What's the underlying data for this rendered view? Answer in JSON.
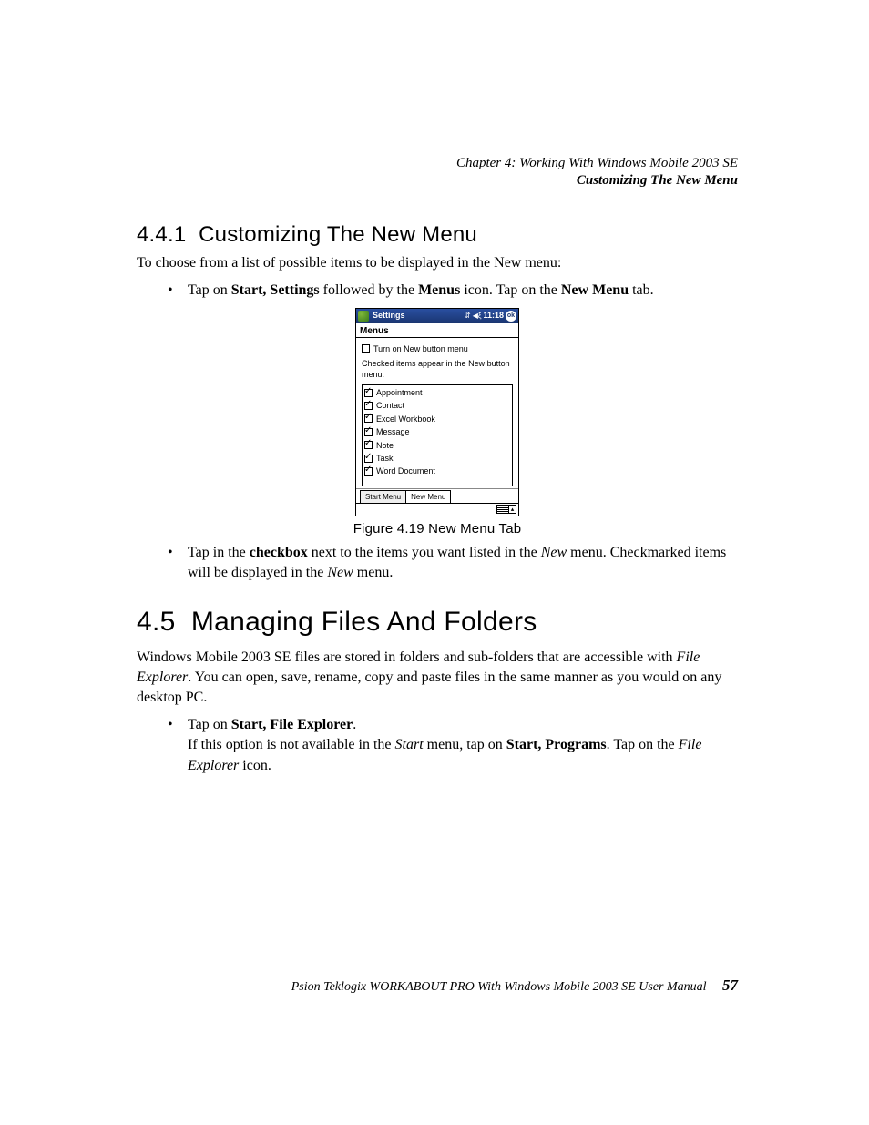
{
  "header": {
    "chapter_line": "Chapter  4:  Working With Windows Mobile 2003 SE",
    "section_line": "Customizing The New Menu"
  },
  "section_441": {
    "number": "4.4.1",
    "title": "Customizing The New Menu",
    "intro": "To choose from a list of possible items to be displayed in the New menu:",
    "bullet1_pre": "Tap on ",
    "bullet1_b1": "Start, Settings",
    "bullet1_mid": " followed by the ",
    "bullet1_b2": "Menus",
    "bullet1_mid2": " icon. Tap on the ",
    "bullet1_b3": "New Menu",
    "bullet1_post": " tab.",
    "bullet2_pre": "Tap in the ",
    "bullet2_b1": "checkbox",
    "bullet2_mid": " next to the items you want listed in the ",
    "bullet2_i1": "New",
    "bullet2_mid2": " menu. Checkmarked items will be displayed in the ",
    "bullet2_i2": "New",
    "bullet2_post": " menu."
  },
  "figure": {
    "caption": "Figure 4.19 New Menu Tab"
  },
  "mock": {
    "title": "Settings",
    "clock": "11:18",
    "ok": "ok",
    "subtitle": "Menus",
    "turn_on_label": "Turn on New button menu",
    "turn_on_checked": false,
    "hint": "Checked items appear in the New button menu.",
    "items": [
      {
        "label": "Appointment",
        "checked": true
      },
      {
        "label": "Contact",
        "checked": true
      },
      {
        "label": "Excel Workbook",
        "checked": true
      },
      {
        "label": "Message",
        "checked": true
      },
      {
        "label": "Note",
        "checked": true
      },
      {
        "label": "Task",
        "checked": true
      },
      {
        "label": "Word Document",
        "checked": true
      }
    ],
    "tab_start": "Start Menu",
    "tab_new": "New Menu"
  },
  "section_45": {
    "number": "4.5",
    "title": "Managing Files And Folders",
    "para_pre": "Windows Mobile 2003 SE files are stored in folders and sub-folders that are accessible with ",
    "para_i1": "File Explorer",
    "para_post": ". You can open, save, rename, copy and paste files in the same manner as you would on any desktop PC.",
    "b1_pre": "Tap on ",
    "b1_b1": "Start, File Explorer",
    "b1_post": ".",
    "b1_line2_pre": "If this option is not available in the ",
    "b1_line2_i1": "Start",
    "b1_line2_mid": " menu, tap on ",
    "b1_line2_b1": "Start, Programs",
    "b1_line2_post": ". Tap on the ",
    "b1_line2_i2": "File Explorer",
    "b1_line2_post2": " icon."
  },
  "footer": {
    "text": "Psion Teklogix WORKABOUT PRO With Windows Mobile 2003 SE User Manual",
    "page": "57"
  }
}
